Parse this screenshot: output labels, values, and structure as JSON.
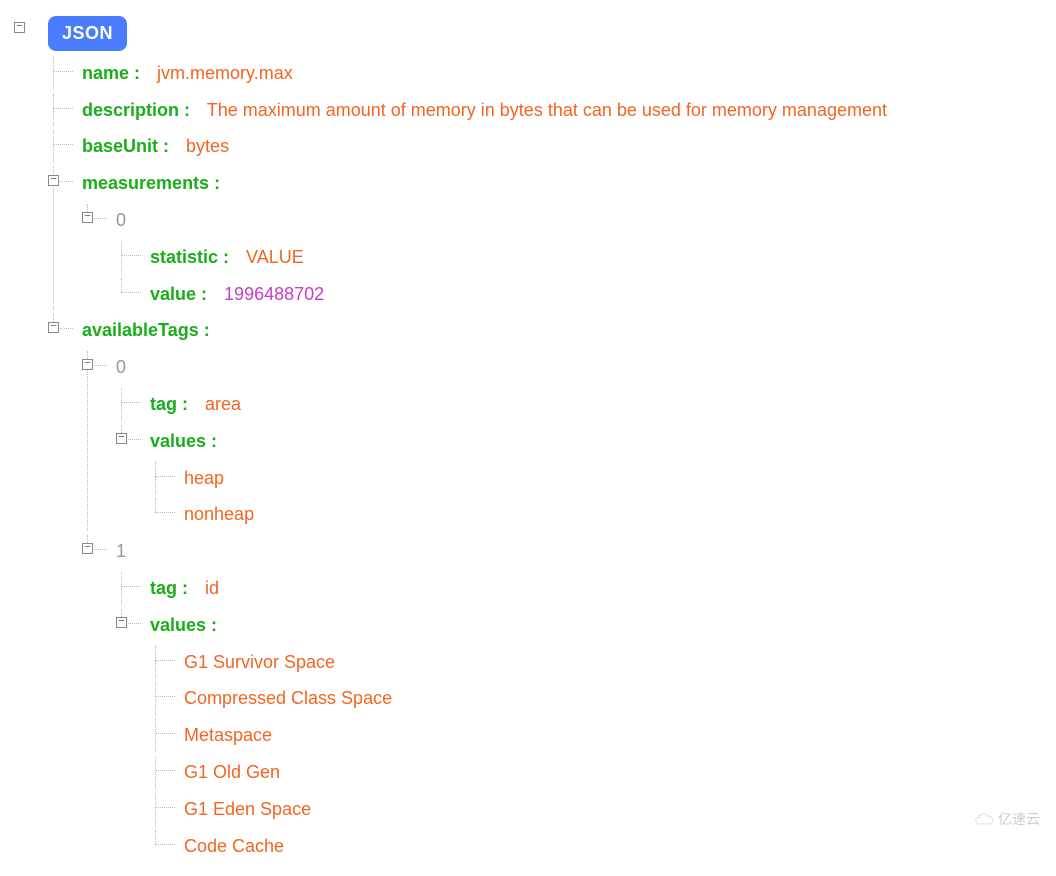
{
  "root_label": "JSON",
  "keys": {
    "name": "name",
    "description": "description",
    "baseUnit": "baseUnit",
    "measurements": "measurements",
    "statistic": "statistic",
    "value": "value",
    "availableTags": "availableTags",
    "tag": "tag",
    "values": "values"
  },
  "data": {
    "name": "jvm.memory.max",
    "description": "The maximum amount of memory in bytes that can be used for memory management",
    "baseUnit": "bytes",
    "measurements": [
      {
        "idx": "0",
        "statistic": "VALUE",
        "value": "1996488702"
      }
    ],
    "availableTags": [
      {
        "idx": "0",
        "tag": "area",
        "values": [
          "heap",
          "nonheap"
        ]
      },
      {
        "idx": "1",
        "tag": "id",
        "values": [
          "G1 Survivor Space",
          "Compressed Class Space",
          "Metaspace",
          "G1 Old Gen",
          "G1 Eden Space",
          "Code Cache"
        ]
      }
    ]
  },
  "watermark": "亿速云"
}
